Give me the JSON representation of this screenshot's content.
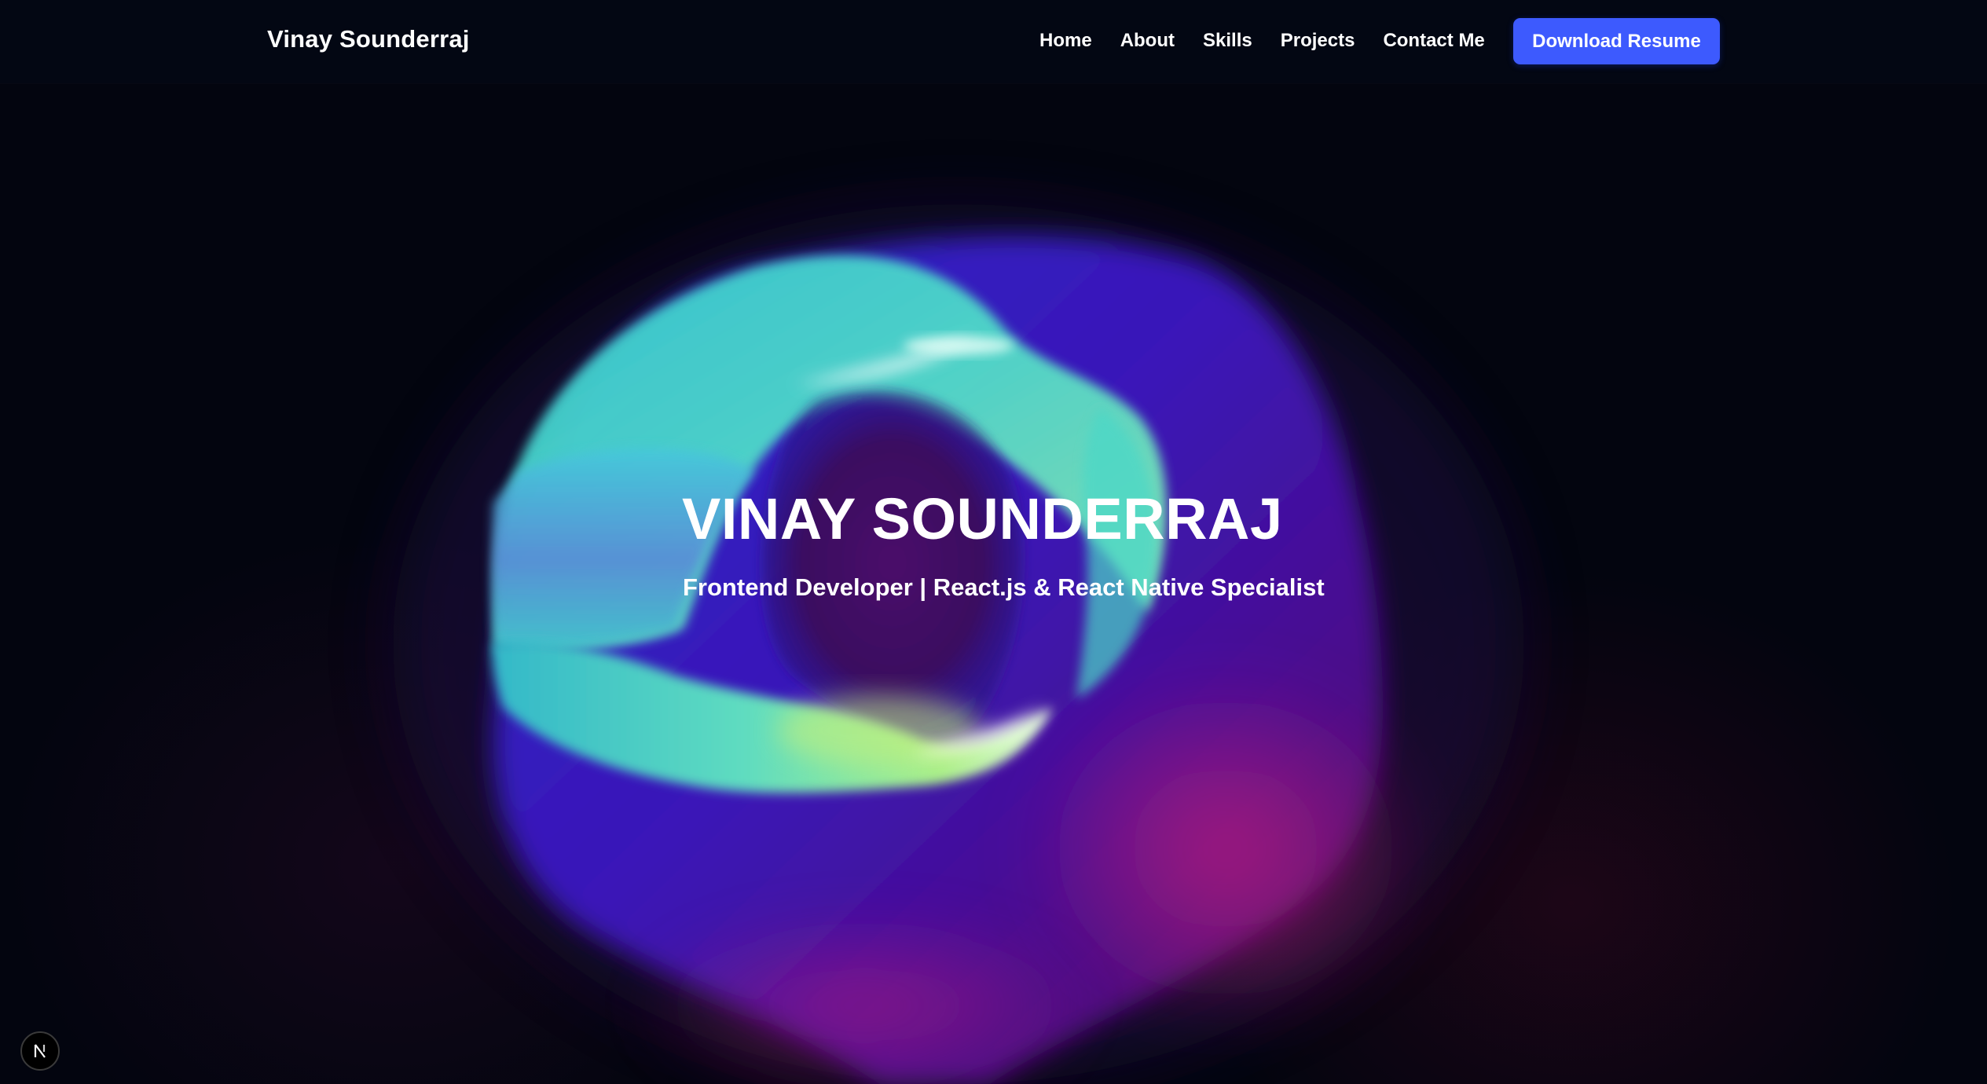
{
  "navbar": {
    "brand": "Vinay Sounderraj",
    "links": [
      {
        "label": "Home"
      },
      {
        "label": "About"
      },
      {
        "label": "Skills"
      },
      {
        "label": "Projects"
      },
      {
        "label": "Contact Me"
      }
    ],
    "resume_button": "Download Resume"
  },
  "hero": {
    "title": "VINAY SOUNDERRAJ",
    "subtitle": "Frontend Developer | React.js & React Native Specialist"
  },
  "dev_indicator": {
    "icon": "next-logo-icon",
    "letter": "N"
  },
  "colors": {
    "background": "#03050f",
    "accent": "#3d5afe",
    "text": "#ffffff"
  }
}
